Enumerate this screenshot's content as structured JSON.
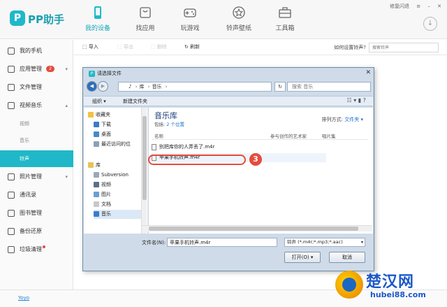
{
  "app": {
    "logo_text": "PP助手",
    "logo_mark": "P",
    "nav_tabs": [
      {
        "label": "我的设备",
        "icon": "phone-icon"
      },
      {
        "label": "找应用",
        "icon": "shopping-bag-icon"
      },
      {
        "label": "玩游戏",
        "icon": "gamepad-icon"
      },
      {
        "label": "铃声壁纸",
        "icon": "star-icon"
      },
      {
        "label": "工具箱",
        "icon": "toolbox-icon"
      }
    ],
    "top_right": {
      "repair": "修复闪退",
      "menu": "≡",
      "minimize": "–",
      "close": "✕"
    }
  },
  "sidebar": {
    "items": [
      {
        "label": "我的手机"
      },
      {
        "label": "应用管理",
        "badge": "2"
      },
      {
        "label": "文件管理"
      },
      {
        "label": "视频音乐"
      },
      {
        "label": "视频"
      },
      {
        "label": "音乐"
      },
      {
        "label": "铃声"
      },
      {
        "label": "照片管理"
      },
      {
        "label": "通讯录"
      },
      {
        "label": "图书管理"
      },
      {
        "label": "备份还原"
      },
      {
        "label": "垃圾清理"
      }
    ]
  },
  "toolbar": {
    "import": "导入",
    "export": "导出",
    "delete": "删除",
    "refresh": "刷新",
    "howto": "如何设置铃声?",
    "search_placeholder": "搜索铃声"
  },
  "status": {
    "link": "Yoyo"
  },
  "dialog": {
    "title": "请选择文件",
    "path": [
      "库",
      "音乐"
    ],
    "search_placeholder": "搜索 音乐",
    "cmd_organize": "组织 ▾",
    "cmd_new_folder": "新建文件夹",
    "tree": [
      "收藏夹",
      "下载",
      "桌面",
      "最近访问的位",
      "库",
      "Subversion",
      "视频",
      "图片",
      "文档",
      "音乐"
    ],
    "library_title": "音乐库",
    "library_sub_prefix": "包括:",
    "library_sub_count": "2 个位置",
    "arrange_label": "排列方式:",
    "arrange_value": "文件夹 ▾",
    "columns": [
      "名称",
      "参与创作的艺术家",
      "唱片集"
    ],
    "files": [
      "别把库你的人弄丢了.m4r",
      "苹果手机铃声.m4r"
    ],
    "step_number": "3",
    "filename_label": "文件名(N):",
    "filename_value": "苹果手机铃声.m4r",
    "filetype": "铃声 (*.m4r;*.mp3;*.aac)",
    "open_button": "打开(O)",
    "cancel_button": "取消"
  },
  "watermark": {
    "title": "楚汉网",
    "url": "hubei88.com"
  },
  "colors": {
    "accent": "#20b8c8",
    "badge": "#e64b3c",
    "dialog_bg": "#cfdbe8"
  }
}
